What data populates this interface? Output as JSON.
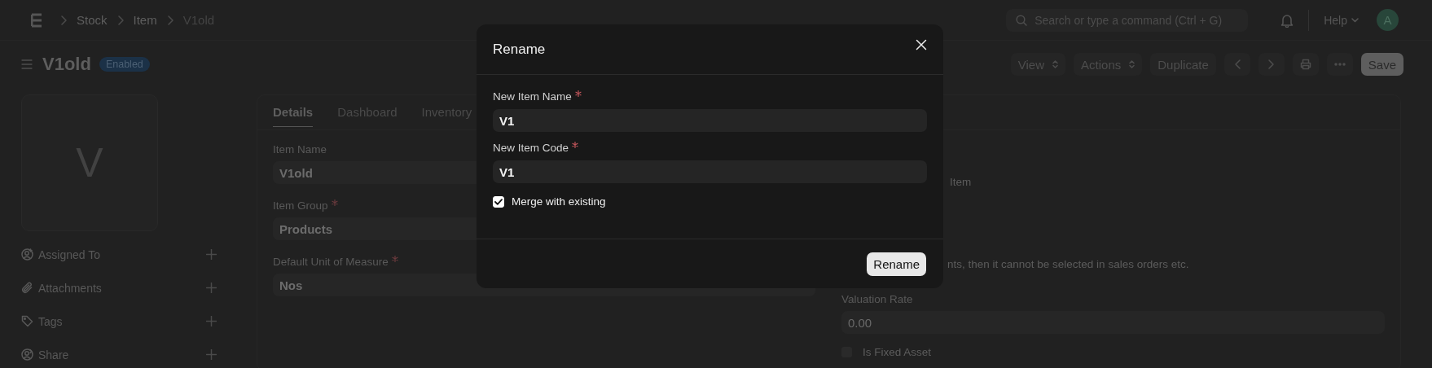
{
  "breadcrumbs": [
    "Stock",
    "Item",
    "V1old"
  ],
  "search": {
    "placeholder": "Search or type a command (Ctrl + G)"
  },
  "help_menu": "Help",
  "avatar": "A",
  "page": {
    "title": "V1old",
    "status": "Enabled"
  },
  "toolbar": [
    {
      "kind": "dropdown",
      "label": "View"
    },
    {
      "kind": "dropdown",
      "label": "Actions"
    },
    {
      "kind": "plain",
      "label": "Duplicate"
    },
    {
      "kind": "prev"
    },
    {
      "kind": "next"
    },
    {
      "kind": "print"
    },
    {
      "kind": "more"
    },
    {
      "kind": "primary",
      "label": "Save"
    }
  ],
  "sidebar": {
    "image_letter": "V",
    "items": [
      {
        "kind": "assign",
        "label": "Assigned To"
      },
      {
        "kind": "attach",
        "label": "Attachments"
      },
      {
        "kind": "tag",
        "label": "Tags"
      },
      {
        "kind": "share",
        "label": "Share"
      }
    ]
  },
  "tabs": [
    {
      "label": "Details",
      "selected": true
    },
    {
      "label": "Dashboard",
      "selected": false
    },
    {
      "label": "Inventory",
      "selected": false
    }
  ],
  "fields_left": [
    {
      "label": "Item Name",
      "required": false,
      "value": "V1old"
    },
    {
      "label": "Item Group",
      "required": true,
      "value": "Products"
    },
    {
      "label": "Default Unit of Measure",
      "required": true,
      "value": "Nos"
    }
  ],
  "fields_right": [
    {
      "kind": "text",
      "text": "Item"
    },
    {
      "kind": "text",
      "text": "nts, then it cannot be selected in sales orders etc."
    },
    {
      "kind": "field",
      "label": "Valuation Rate",
      "value": "0.00"
    },
    {
      "kind": "checkbox",
      "label": "Is Fixed Asset",
      "checked": false
    }
  ],
  "dialog": {
    "title": "Rename",
    "fields": [
      {
        "label": "New Item Name",
        "required": true,
        "value": "V1"
      },
      {
        "label": "New Item Code",
        "required": true,
        "value": "V1"
      }
    ],
    "merge": {
      "label": "Merge with existing",
      "checked": true
    },
    "button": "Rename"
  }
}
